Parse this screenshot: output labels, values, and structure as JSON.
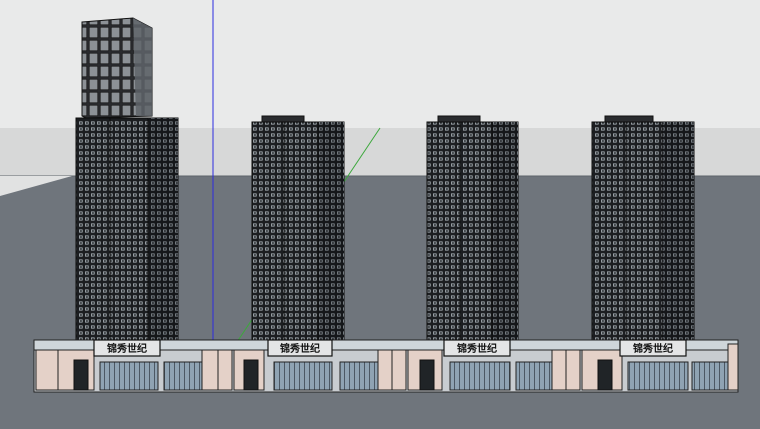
{
  "scene": {
    "sky_color": "#e9eaea",
    "horizon_color": "#d7d8d8",
    "ground_color": "#6f757c",
    "axis_blue": "#2c2ce0",
    "axis_green": "#3ca83c",
    "facade_dark": "#1c1e21",
    "glass_color": "#8fa3b3",
    "wall_color": "#e4d1c8",
    "sign_bg": "#e4e5e6",
    "tower_count": 4,
    "storefront_sign_text": "锦秀世纪",
    "storefront_signs": [
      {
        "text": "锦秀世纪"
      },
      {
        "text": "锦秀世纪"
      },
      {
        "text": "锦秀世纪"
      },
      {
        "text": "锦秀世纪"
      }
    ]
  }
}
